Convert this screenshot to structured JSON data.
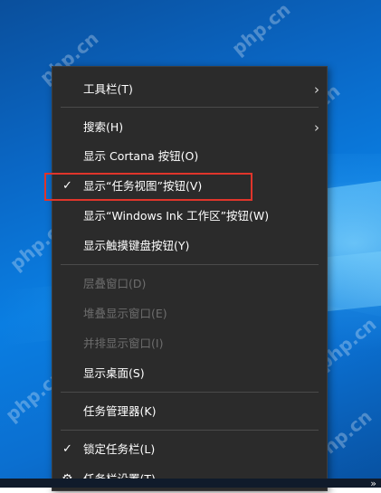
{
  "menu": {
    "toolbars": "工具栏(T)",
    "search": "搜索(H)",
    "show_cortana": "显示 Cortana 按钮(O)",
    "show_task_view": "显示“任务视图”按钮(V)",
    "show_ink": "显示“Windows Ink 工作区”按钮(W)",
    "show_touch_keyboard": "显示触摸键盘按钮(Y)",
    "cascade": "层叠窗口(D)",
    "stack": "堆叠显示窗口(E)",
    "side_by_side": "并排显示窗口(I)",
    "show_desktop": "显示桌面(S)",
    "task_manager": "任务管理器(K)",
    "lock_taskbar": "锁定任务栏(L)",
    "taskbar_settings": "任务栏设置(T)"
  },
  "icons": {
    "check": "✓",
    "submenu": "›",
    "gear": "⚙",
    "tray_expand": "»"
  },
  "watermark_text": "php.cn",
  "colors": {
    "menu_bg": "#2b2b2b",
    "highlight_border": "#e0352b",
    "disabled_text": "#6d6d6d"
  }
}
